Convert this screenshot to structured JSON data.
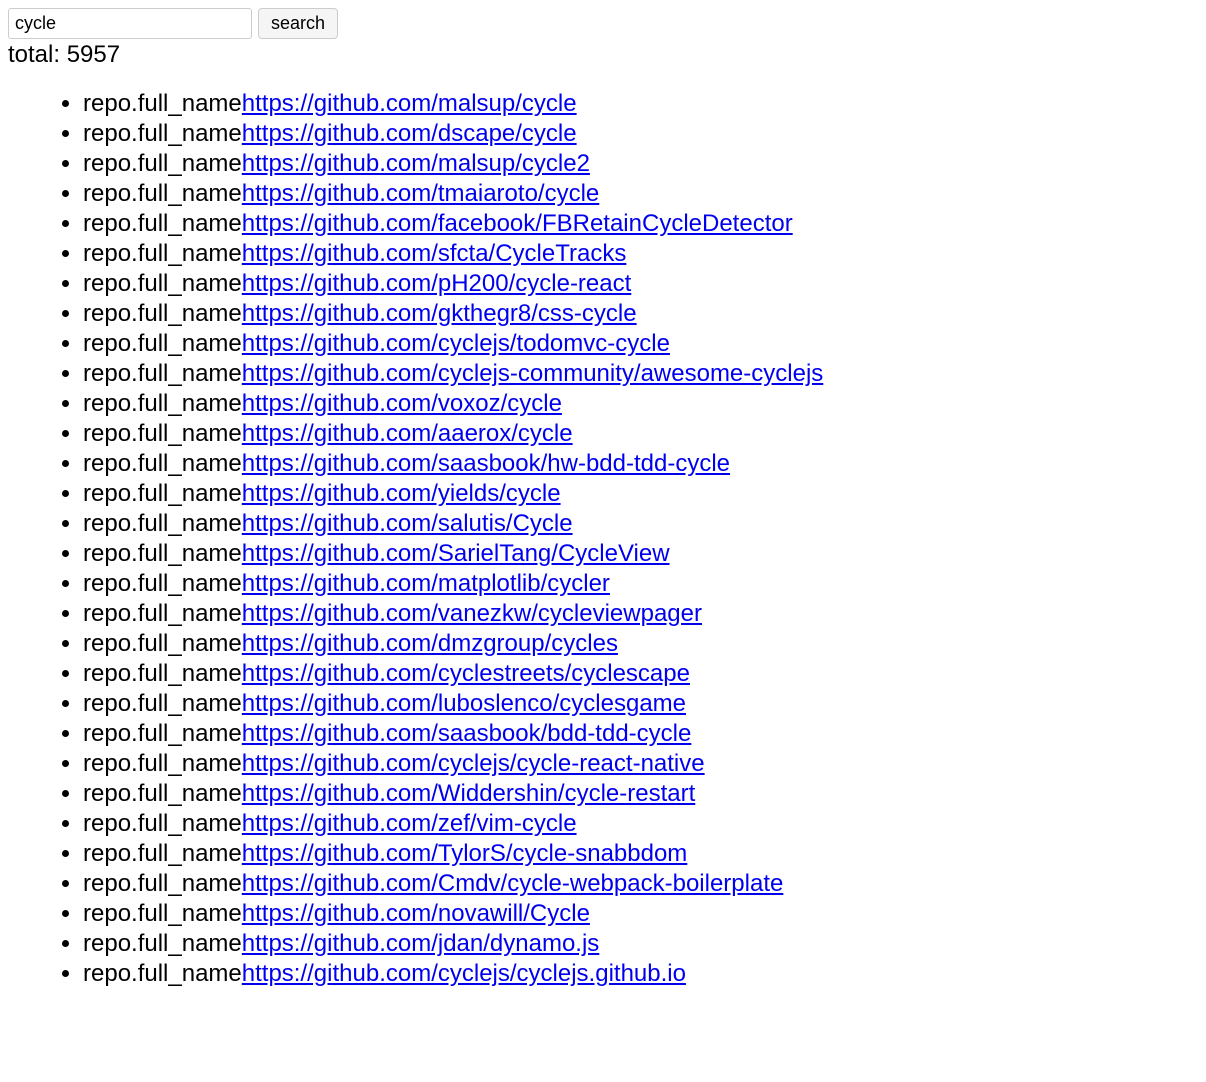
{
  "search": {
    "value": "cycle",
    "button_label": "search"
  },
  "total_prefix": "total: ",
  "total_count": "5957",
  "row_label": "repo.full_name",
  "results": [
    {
      "url": "https://github.com/malsup/cycle"
    },
    {
      "url": "https://github.com/dscape/cycle"
    },
    {
      "url": "https://github.com/malsup/cycle2"
    },
    {
      "url": "https://github.com/tmaiaroto/cycle"
    },
    {
      "url": "https://github.com/facebook/FBRetainCycleDetector"
    },
    {
      "url": "https://github.com/sfcta/CycleTracks"
    },
    {
      "url": "https://github.com/pH200/cycle-react"
    },
    {
      "url": "https://github.com/gkthegr8/css-cycle"
    },
    {
      "url": "https://github.com/cyclejs/todomvc-cycle"
    },
    {
      "url": "https://github.com/cyclejs-community/awesome-cyclejs"
    },
    {
      "url": "https://github.com/voxoz/cycle"
    },
    {
      "url": "https://github.com/aaerox/cycle"
    },
    {
      "url": "https://github.com/saasbook/hw-bdd-tdd-cycle"
    },
    {
      "url": "https://github.com/yields/cycle"
    },
    {
      "url": "https://github.com/salutis/Cycle"
    },
    {
      "url": "https://github.com/SarielTang/CycleView"
    },
    {
      "url": "https://github.com/matplotlib/cycler"
    },
    {
      "url": "https://github.com/vanezkw/cycleviewpager"
    },
    {
      "url": "https://github.com/dmzgroup/cycles"
    },
    {
      "url": "https://github.com/cyclestreets/cyclescape"
    },
    {
      "url": "https://github.com/luboslenco/cyclesgame"
    },
    {
      "url": "https://github.com/saasbook/bdd-tdd-cycle"
    },
    {
      "url": "https://github.com/cyclejs/cycle-react-native"
    },
    {
      "url": "https://github.com/Widdershin/cycle-restart"
    },
    {
      "url": "https://github.com/zef/vim-cycle"
    },
    {
      "url": "https://github.com/TylorS/cycle-snabbdom"
    },
    {
      "url": "https://github.com/Cmdv/cycle-webpack-boilerplate"
    },
    {
      "url": "https://github.com/novawill/Cycle"
    },
    {
      "url": "https://github.com/jdan/dynamo.js"
    },
    {
      "url": "https://github.com/cyclejs/cyclejs.github.io"
    }
  ]
}
